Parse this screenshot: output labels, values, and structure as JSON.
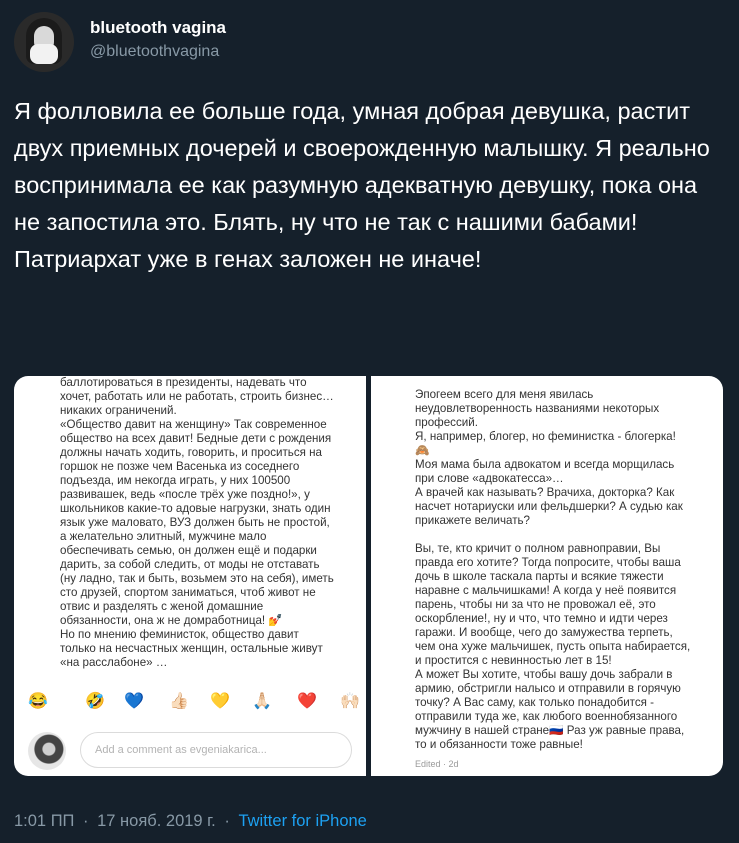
{
  "author": {
    "display_name": "bluetooth vagina",
    "handle": "@bluetoothvagina"
  },
  "tweet": {
    "text": "Я фолловила ее больше года, умная добрая девушка, растит двух приемных дочерей и своерожденную малышку. Я реально воспринимала ее как разумную адекватную девушку, пока она не запостила это. Блять, ну что не так с нашими бабами! Патриархат уже в генах заложен не иначе!"
  },
  "media": {
    "left_text": "баллотироваться в президенты, надевать что\nхочет, работать или не работать, строить бизнес…\nникаких ограничений.\n«Общество давит на женщину» Так современное\nобщество на всех давит! Бедные дети с рождения\nдолжны начать ходить, говорить, и проситься на\nгоршок не позже чем Васенька из соседнего\nподъезда, им некогда играть, у них 100500\nразвивашек, ведь «после трёх уже поздно!», у\nшкольников какие-то адовые нагрузки, знать один\nязык уже маловато, ВУЗ должен быть не простой,\nа желательно элитный, мужчине мало\nобеспечивать семью, он должен ещё и подарки\nдарить, за собой следить, от моды не отставать\n(ну ладно, так и быть, возьмем это на себя), иметь\nсто друзей, спортом заниматься, чтоб живот не\nотвис и разделять с женой домашние\nобязанности, она ж не домработница! 💅\nНо по мнению феминисток, общество давит\nтолько на несчастных женщин, остальные живут\n«на расслабоне» …",
    "emojis": [
      "😂",
      "🤣",
      "💙",
      "👍🏻",
      "💛",
      "🙏🏻",
      "❤️",
      "🙌🏻"
    ],
    "comment_placeholder": "Add a comment as evgeniakarica...",
    "right_text": "Эпогеем всего для меня явилась\nнеудовлетворенность названиями некоторых\nпрофессий.\nЯ, например, блогер, но феминистка - блогерка!\n🙈\nМоя мама была адвокатом и всегда морщилась\nпри слове «адвокатесса»…\nА врачей как называть? Врачиха, докторка? Как\nнасчет нотариуски или фельдшерки? А судью как\nприкажете величать?\n\nВы, те, кто кричит о полном равноправии, Вы\nправда его хотите? Тогда попросите, чтобы ваша\nдочь в школе таскала парты и всякие тяжести\nнаравне с мальчишками! А когда у неё появится\nпарень, чтобы ни за что не провожал её, это\nоскорбление!, ну и что, что темно и идти через\nгаражи. И вообще, чего до замужества терпеть,\nчем она хуже мальчишек, пусть опыта набирается,\nи простится с невинностью лет в 15!\nА может Вы хотите, чтобы вашу дочь забрали в\nармию, обстригли налысо и отправили в горячую\nточку? А Вас саму, как только понадобится -\nотправили туда же, как любого военнобязанного\nмужчину в нашей стране🇷🇺 Раз уж равные права,\nто и обязанности тоже равные!",
    "edited_label": "Edited · 2d"
  },
  "footer": {
    "time": "1:01 ПП",
    "separator": "·",
    "date": "17 нояб. 2019 г.",
    "source": "Twitter for iPhone"
  },
  "colors": {
    "background": "#15202b",
    "secondary_text": "#8899a6",
    "link": "#1da1f2"
  }
}
